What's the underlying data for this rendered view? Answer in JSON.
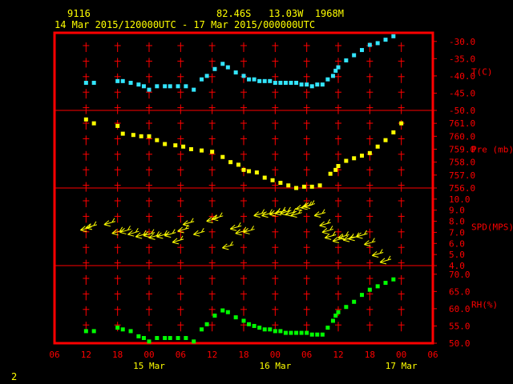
{
  "header": {
    "station": "9116",
    "location": "82.46S   13.03W  1968M",
    "period": "14 Mar 2015/120000UTC - 17 Mar 2015/000000UTC"
  },
  "footer": {
    "page_number": "2"
  },
  "colors": {
    "frame": "#ff0000",
    "labels": "#ff0000",
    "time_labels": "#ffff00",
    "temperature": "#33e5ff",
    "pressure": "#ffff00",
    "wind": "#ffff00",
    "humidity": "#00ff00"
  },
  "chart_data": {
    "type": "scatter",
    "x_unit": "hours since 14 Mar 2015 06UTC",
    "xlim": [
      0,
      72
    ],
    "x_ticks": [
      {
        "x": 0,
        "label": "06"
      },
      {
        "x": 6,
        "label": "12"
      },
      {
        "x": 12,
        "label": "18"
      },
      {
        "x": 18,
        "label": "00"
      },
      {
        "x": 24,
        "label": "06"
      },
      {
        "x": 30,
        "label": "12"
      },
      {
        "x": 36,
        "label": "18"
      },
      {
        "x": 42,
        "label": "00"
      },
      {
        "x": 48,
        "label": "06"
      },
      {
        "x": 54,
        "label": "12"
      },
      {
        "x": 60,
        "label": "18"
      },
      {
        "x": 66,
        "label": "00"
      },
      {
        "x": 72,
        "label": "06"
      }
    ],
    "date_labels": [
      {
        "x": 18,
        "label": "15 Mar"
      },
      {
        "x": 42,
        "label": "16 Mar"
      },
      {
        "x": 66,
        "label": "17 Mar"
      }
    ],
    "panels": [
      {
        "name": "T(C)",
        "ylim": [
          -50,
          -27.5
        ],
        "ticks": [
          -30.0,
          -35.0,
          -40.0,
          -45.0,
          -50.0
        ],
        "series": [
          {
            "x": 6,
            "y": -42.0
          },
          {
            "x": 7.5,
            "y": -42.0
          },
          {
            "x": 12,
            "y": -41.5
          },
          {
            "x": 13,
            "y": -41.5
          },
          {
            "x": 14.5,
            "y": -42.0
          },
          {
            "x": 16,
            "y": -42.5
          },
          {
            "x": 17,
            "y": -43.0
          },
          {
            "x": 18,
            "y": -44.0
          },
          {
            "x": 19.5,
            "y": -43.0
          },
          {
            "x": 21,
            "y": -43.0
          },
          {
            "x": 22,
            "y": -43.0
          },
          {
            "x": 23.5,
            "y": -43.0
          },
          {
            "x": 25,
            "y": -43.0
          },
          {
            "x": 26.5,
            "y": -44.0
          },
          {
            "x": 28,
            "y": -41.0
          },
          {
            "x": 29,
            "y": -40.0
          },
          {
            "x": 30.5,
            "y": -38.0
          },
          {
            "x": 32,
            "y": -36.5
          },
          {
            "x": 33,
            "y": -37.5
          },
          {
            "x": 34.5,
            "y": -39.0
          },
          {
            "x": 36,
            "y": -40.0
          },
          {
            "x": 37,
            "y": -41.0
          },
          {
            "x": 38,
            "y": -41.0
          },
          {
            "x": 39,
            "y": -41.5
          },
          {
            "x": 40,
            "y": -41.5
          },
          {
            "x": 41,
            "y": -41.5
          },
          {
            "x": 42,
            "y": -42.0
          },
          {
            "x": 43,
            "y": -42.0
          },
          {
            "x": 44,
            "y": -42.0
          },
          {
            "x": 45,
            "y": -42.0
          },
          {
            "x": 46,
            "y": -42.0
          },
          {
            "x": 47,
            "y": -42.5
          },
          {
            "x": 48,
            "y": -42.5
          },
          {
            "x": 49,
            "y": -43.0
          },
          {
            "x": 50,
            "y": -42.5
          },
          {
            "x": 51,
            "y": -42.5
          },
          {
            "x": 52,
            "y": -41.0
          },
          {
            "x": 53,
            "y": -40.0
          },
          {
            "x": 53.5,
            "y": -38.5
          },
          {
            "x": 54,
            "y": -37.5
          },
          {
            "x": 55.5,
            "y": -35.5
          },
          {
            "x": 57,
            "y": -34.0
          },
          {
            "x": 58.5,
            "y": -32.5
          },
          {
            "x": 60,
            "y": -31.0
          },
          {
            "x": 61.5,
            "y": -30.5
          },
          {
            "x": 63,
            "y": -29.5
          },
          {
            "x": 64.5,
            "y": -28.5
          }
        ]
      },
      {
        "name": "Pre (mb)",
        "ylim": [
          756,
          762
        ],
        "ticks": [
          761.0,
          760.0,
          759.0,
          758.0,
          757.0,
          756.0
        ],
        "series": [
          {
            "x": 6,
            "y": 761.3
          },
          {
            "x": 7.5,
            "y": 761.0
          },
          {
            "x": 12,
            "y": 760.8
          },
          {
            "x": 13,
            "y": 760.2
          },
          {
            "x": 15,
            "y": 760.1
          },
          {
            "x": 16.5,
            "y": 760.0
          },
          {
            "x": 18,
            "y": 760.0
          },
          {
            "x": 19.5,
            "y": 759.7
          },
          {
            "x": 21,
            "y": 759.4
          },
          {
            "x": 23,
            "y": 759.3
          },
          {
            "x": 24.5,
            "y": 759.2
          },
          {
            "x": 26,
            "y": 759.0
          },
          {
            "x": 28,
            "y": 758.9
          },
          {
            "x": 30,
            "y": 758.8
          },
          {
            "x": 32,
            "y": 758.4
          },
          {
            "x": 33.5,
            "y": 758.0
          },
          {
            "x": 35,
            "y": 757.8
          },
          {
            "x": 36,
            "y": 757.4
          },
          {
            "x": 37,
            "y": 757.3
          },
          {
            "x": 38.5,
            "y": 757.2
          },
          {
            "x": 40,
            "y": 756.8
          },
          {
            "x": 41.5,
            "y": 756.6
          },
          {
            "x": 43,
            "y": 756.4
          },
          {
            "x": 44.5,
            "y": 756.2
          },
          {
            "x": 46,
            "y": 756.0
          },
          {
            "x": 47.5,
            "y": 756.1
          },
          {
            "x": 49,
            "y": 756.1
          },
          {
            "x": 50.5,
            "y": 756.2
          },
          {
            "x": 52.5,
            "y": 757.1
          },
          {
            "x": 53.5,
            "y": 757.4
          },
          {
            "x": 54,
            "y": 757.7
          },
          {
            "x": 55.5,
            "y": 758.1
          },
          {
            "x": 57,
            "y": 758.3
          },
          {
            "x": 58.5,
            "y": 758.5
          },
          {
            "x": 60,
            "y": 758.7
          },
          {
            "x": 61.5,
            "y": 759.2
          },
          {
            "x": 63,
            "y": 759.7
          },
          {
            "x": 64.5,
            "y": 760.3
          },
          {
            "x": 66,
            "y": 761.0
          }
        ]
      },
      {
        "name": "SPD(MPS)",
        "ylim": [
          4,
          11
        ],
        "ticks": [
          10.0,
          9.0,
          8.0,
          7.0,
          6.0,
          5.0,
          4.0
        ],
        "series": [
          {
            "x": 6,
            "y": 7.2
          },
          {
            "x": 7,
            "y": 7.4
          },
          {
            "x": 10.5,
            "y": 7.7
          },
          {
            "x": 12,
            "y": 6.9
          },
          {
            "x": 13.5,
            "y": 7.0
          },
          {
            "x": 15,
            "y": 6.8
          },
          {
            "x": 16.5,
            "y": 6.6
          },
          {
            "x": 18,
            "y": 6.7
          },
          {
            "x": 19,
            "y": 6.5
          },
          {
            "x": 20.5,
            "y": 6.6
          },
          {
            "x": 22,
            "y": 6.7
          },
          {
            "x": 23.5,
            "y": 6.1
          },
          {
            "x": 24.5,
            "y": 7.1
          },
          {
            "x": 25.5,
            "y": 7.7
          },
          {
            "x": 27.5,
            "y": 6.8
          },
          {
            "x": 30,
            "y": 8.0
          },
          {
            "x": 31,
            "y": 8.2
          },
          {
            "x": 33,
            "y": 5.6
          },
          {
            "x": 34.5,
            "y": 7.3
          },
          {
            "x": 35.5,
            "y": 6.9
          },
          {
            "x": 37,
            "y": 7.0
          },
          {
            "x": 39,
            "y": 8.5
          },
          {
            "x": 40.5,
            "y": 8.5
          },
          {
            "x": 42,
            "y": 8.6
          },
          {
            "x": 43,
            "y": 8.7
          },
          {
            "x": 44,
            "y": 8.7
          },
          {
            "x": 45,
            "y": 8.6
          },
          {
            "x": 46,
            "y": 8.5
          },
          {
            "x": 47,
            "y": 9.1
          },
          {
            "x": 48,
            "y": 9.2
          },
          {
            "x": 48.5,
            "y": 9.3
          },
          {
            "x": 50.5,
            "y": 8.5
          },
          {
            "x": 51.5,
            "y": 7.6
          },
          {
            "x": 52,
            "y": 7.0
          },
          {
            "x": 52.5,
            "y": 6.5
          },
          {
            "x": 54,
            "y": 6.2
          },
          {
            "x": 55,
            "y": 6.5
          },
          {
            "x": 56,
            "y": 6.3
          },
          {
            "x": 57,
            "y": 6.4
          },
          {
            "x": 58.5,
            "y": 6.6
          },
          {
            "x": 60,
            "y": 5.9
          },
          {
            "x": 61.5,
            "y": 4.9
          },
          {
            "x": 63,
            "y": 4.3
          }
        ]
      },
      {
        "name": "RH(%)",
        "ylim": [
          50,
          72.5
        ],
        "ticks": [
          70.0,
          65.0,
          60.0,
          55.0,
          50.0
        ],
        "series": [
          {
            "x": 6,
            "y": 53.5
          },
          {
            "x": 7.5,
            "y": 53.5
          },
          {
            "x": 12,
            "y": 54.5
          },
          {
            "x": 13,
            "y": 54.0
          },
          {
            "x": 14.5,
            "y": 53.5
          },
          {
            "x": 16,
            "y": 52.0
          },
          {
            "x": 17,
            "y": 51.5
          },
          {
            "x": 18,
            "y": 50.5
          },
          {
            "x": 19.5,
            "y": 51.5
          },
          {
            "x": 21,
            "y": 51.5
          },
          {
            "x": 22,
            "y": 51.5
          },
          {
            "x": 23.5,
            "y": 51.5
          },
          {
            "x": 25,
            "y": 51.5
          },
          {
            "x": 26.5,
            "y": 50.5
          },
          {
            "x": 28,
            "y": 54.0
          },
          {
            "x": 29,
            "y": 55.5
          },
          {
            "x": 30.5,
            "y": 58.0
          },
          {
            "x": 32,
            "y": 59.5
          },
          {
            "x": 33,
            "y": 59.0
          },
          {
            "x": 34.5,
            "y": 57.5
          },
          {
            "x": 36,
            "y": 56.5
          },
          {
            "x": 37,
            "y": 55.5
          },
          {
            "x": 38,
            "y": 55.0
          },
          {
            "x": 39,
            "y": 54.5
          },
          {
            "x": 40,
            "y": 54.0
          },
          {
            "x": 41,
            "y": 54.0
          },
          {
            "x": 42,
            "y": 53.5
          },
          {
            "x": 43,
            "y": 53.5
          },
          {
            "x": 44,
            "y": 53.0
          },
          {
            "x": 45,
            "y": 53.0
          },
          {
            "x": 46,
            "y": 53.0
          },
          {
            "x": 47,
            "y": 53.0
          },
          {
            "x": 48,
            "y": 53.0
          },
          {
            "x": 49,
            "y": 52.5
          },
          {
            "x": 50,
            "y": 52.5
          },
          {
            "x": 51,
            "y": 52.5
          },
          {
            "x": 52,
            "y": 54.5
          },
          {
            "x": 53,
            "y": 56.5
          },
          {
            "x": 53.5,
            "y": 58.0
          },
          {
            "x": 54,
            "y": 59.0
          },
          {
            "x": 55.5,
            "y": 60.5
          },
          {
            "x": 57,
            "y": 62.0
          },
          {
            "x": 58.5,
            "y": 64.0
          },
          {
            "x": 60,
            "y": 65.5
          },
          {
            "x": 61.5,
            "y": 66.5
          },
          {
            "x": 63,
            "y": 67.5
          },
          {
            "x": 64.5,
            "y": 68.5
          }
        ]
      }
    ]
  }
}
